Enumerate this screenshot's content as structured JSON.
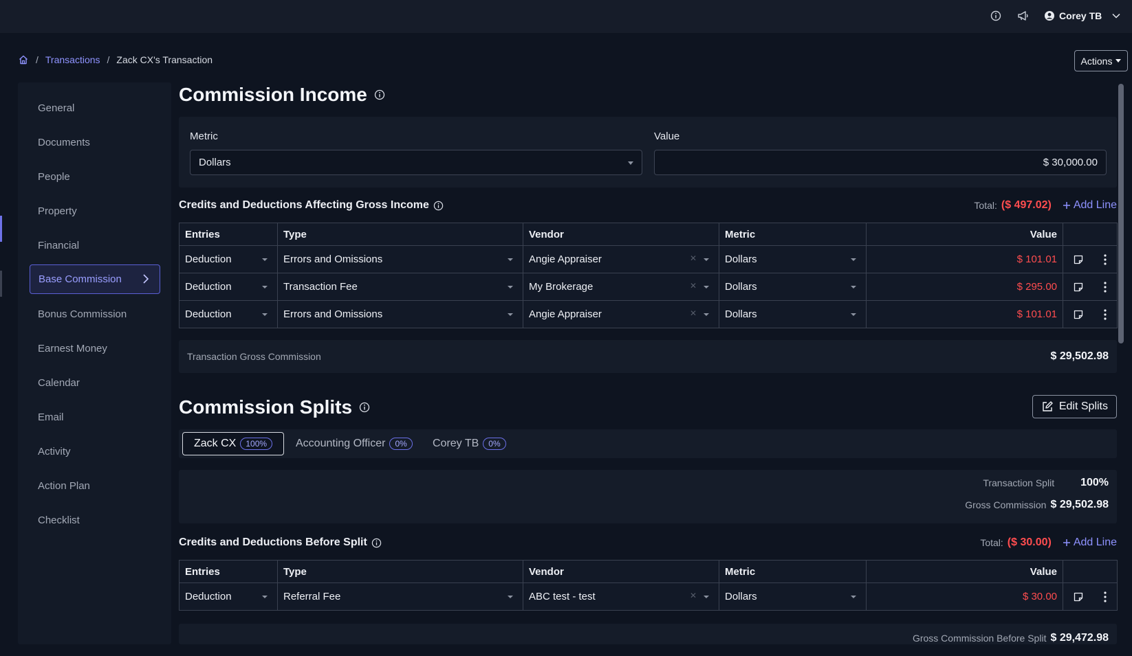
{
  "topbar": {
    "user_name": "Corey TB"
  },
  "breadcrumb": {
    "items": [
      "Transactions",
      "Zack CX's Transaction"
    ]
  },
  "actions": {
    "label": "Actions"
  },
  "sidebar": {
    "items": [
      {
        "label": "General"
      },
      {
        "label": "Documents"
      },
      {
        "label": "People"
      },
      {
        "label": "Property"
      },
      {
        "label": "Financial"
      },
      {
        "label": "Base Commission",
        "active": true
      },
      {
        "label": "Bonus Commission"
      },
      {
        "label": "Earnest Money"
      },
      {
        "label": "Calendar"
      },
      {
        "label": "Email"
      },
      {
        "label": "Activity"
      },
      {
        "label": "Action Plan"
      },
      {
        "label": "Checklist"
      }
    ]
  },
  "commission_income": {
    "title": "Commission Income",
    "metric_label": "Metric",
    "metric_value": "Dollars",
    "value_label": "Value",
    "value": "$ 30,000.00"
  },
  "gross_credits": {
    "title": "Credits and Deductions Affecting Gross Income",
    "total_label": "Total:",
    "total_value": "($ 497.02)",
    "add_line": "Add Line",
    "columns": [
      "Entries",
      "Type",
      "Vendor",
      "Metric",
      "Value"
    ],
    "rows": [
      {
        "entry": "Deduction",
        "type": "Errors and Omissions",
        "vendor": "Angie Appraiser",
        "metric": "Dollars",
        "value": "$ 101.01"
      },
      {
        "entry": "Deduction",
        "type": "Transaction Fee",
        "vendor": "My Brokerage",
        "metric": "Dollars",
        "value": "$ 295.00"
      },
      {
        "entry": "Deduction",
        "type": "Errors and Omissions",
        "vendor": "Angie Appraiser",
        "metric": "Dollars",
        "value": "$ 101.01"
      }
    ],
    "summary_label": "Transaction Gross Commission",
    "summary_value": "$ 29,502.98"
  },
  "commission_splits": {
    "title": "Commission Splits",
    "edit_label": "Edit Splits",
    "tabs": [
      {
        "name": "Zack CX",
        "pct": "100%"
      },
      {
        "name": "Accounting Officer",
        "pct": "0%"
      },
      {
        "name": "Corey TB",
        "pct": "0%"
      }
    ],
    "split_label": "Transaction Split",
    "split_value": "100%",
    "gross_label": "Gross Commission",
    "gross_value": "$ 29,502.98"
  },
  "before_split": {
    "title": "Credits and Deductions Before Split",
    "total_label": "Total:",
    "total_value": "($ 30.00)",
    "add_line": "Add Line",
    "columns": [
      "Entries",
      "Type",
      "Vendor",
      "Metric",
      "Value"
    ],
    "rows": [
      {
        "entry": "Deduction",
        "type": "Referral Fee",
        "vendor": "ABC test - test",
        "metric": "Dollars",
        "value": "$ 30.00"
      }
    ],
    "summary_label": "Gross Commission Before Split",
    "summary_value": "$ 29,472.98"
  },
  "colors": {
    "accent": "#8e92ff",
    "negative": "#ff4d4f",
    "background": "#0e1420"
  }
}
